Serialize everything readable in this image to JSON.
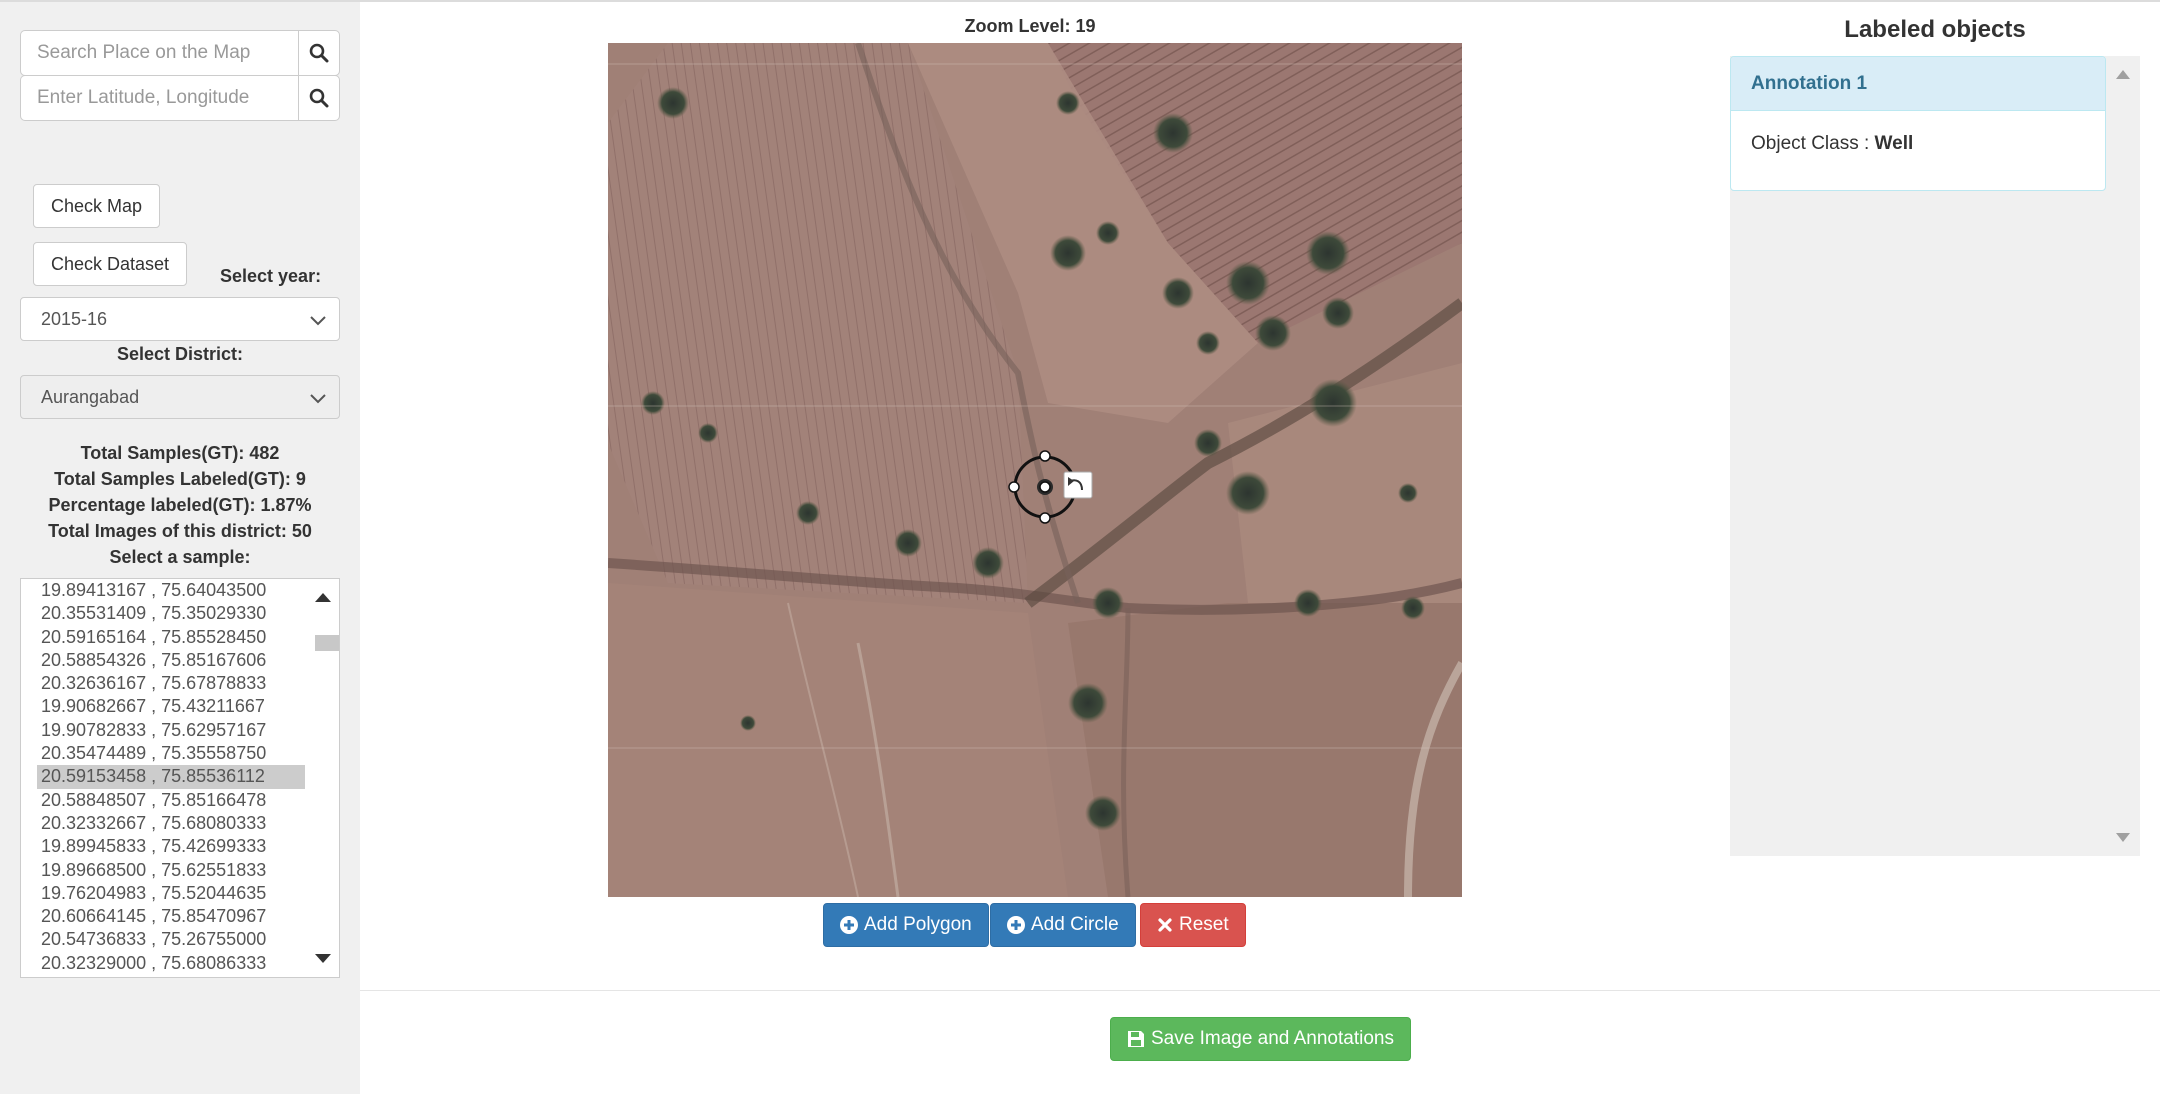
{
  "sidebar": {
    "search_place": {
      "placeholder": "Search Place on the Map"
    },
    "search_latlng": {
      "placeholder": "Enter Latitude, Longitude"
    },
    "check_map_label": "Check Map",
    "check_dataset_label": "Check Dataset",
    "select_year_label": "Select year:",
    "year_value": "2015-16",
    "select_district_label": "Select District:",
    "district_value": "Aurangabad",
    "stats": {
      "total_samples": "Total Samples(GT): 482",
      "total_labeled": "Total Samples Labeled(GT): 9",
      "percentage_labeled": "Percentage labeled(GT): 1.87%",
      "total_images": "Total Images of this district: 50"
    },
    "select_sample_label": "Select a sample:",
    "samples": [
      "19.89413167 , 75.64043500",
      "20.35531409 , 75.35029330",
      "20.59165164 , 75.85528450",
      "20.58854326 , 75.85167606",
      "20.32636167 , 75.67878833",
      "19.90682667 , 75.43211667",
      "19.90782833 , 75.62957167",
      "20.35474489 , 75.35558750",
      "20.59153458 , 75.85536112",
      "20.58848507 , 75.85166478",
      "20.32332667 , 75.68080333",
      "19.89945833 , 75.42699333",
      "19.89668500 , 75.62551833",
      "19.76204983 , 75.52044635",
      "20.60664145 , 75.85470967",
      "20.54736833 , 75.26755000",
      "20.32329000 , 75.68086333"
    ],
    "selected_sample_index": 8
  },
  "main": {
    "zoom_label": "Zoom Level: 19",
    "add_polygon_label": "Add Polygon",
    "add_circle_label": "Add Circle",
    "reset_label": "Reset",
    "save_label": "Save Image and Annotations"
  },
  "right": {
    "title": "Labeled objects",
    "annotations": [
      {
        "heading": "Annotation 1",
        "class_label": "Object Class :",
        "class_value": "Well"
      }
    ]
  },
  "colors": {
    "primary": "#337ab7",
    "danger": "#d9534f",
    "success": "#5cb85c",
    "panel_heading": "#d9edf7"
  }
}
